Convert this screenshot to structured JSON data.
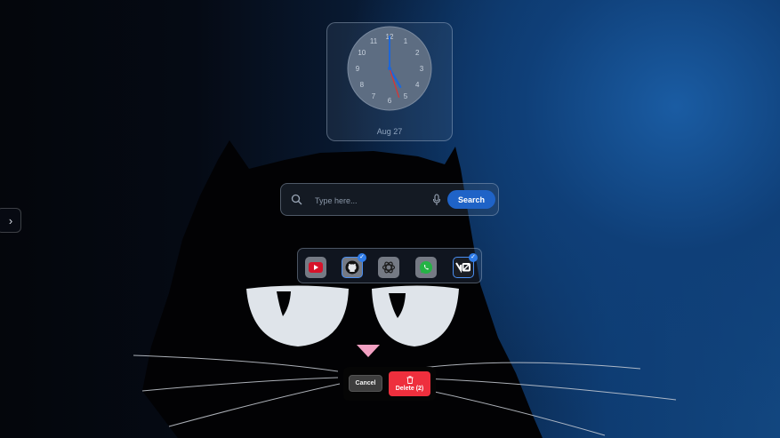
{
  "clock": {
    "hour": 5,
    "minute": 0,
    "second": 27,
    "numbers": [
      "12",
      "1",
      "2",
      "3",
      "4",
      "5",
      "6",
      "7",
      "8",
      "9",
      "10",
      "11"
    ],
    "date": "Aug 27"
  },
  "search": {
    "placeholder": "Type here...",
    "value": "",
    "button_label": "Search"
  },
  "shortcuts": [
    {
      "name": "youtube",
      "selected": false,
      "icon": "youtube-icon"
    },
    {
      "name": "github",
      "selected": true,
      "icon": "github-icon"
    },
    {
      "name": "openai",
      "selected": false,
      "icon": "openai-icon"
    },
    {
      "name": "whatsapp",
      "selected": false,
      "icon": "whatsapp-icon"
    },
    {
      "name": "v0",
      "selected": true,
      "icon": "v0-icon",
      "text": "v0"
    }
  ],
  "actions": {
    "cancel_label": "Cancel",
    "delete_label": "Delete (2)"
  },
  "colors": {
    "accent": "#1f63c7",
    "danger": "#ee2f3d",
    "selected_border": "#4a8ef0"
  }
}
